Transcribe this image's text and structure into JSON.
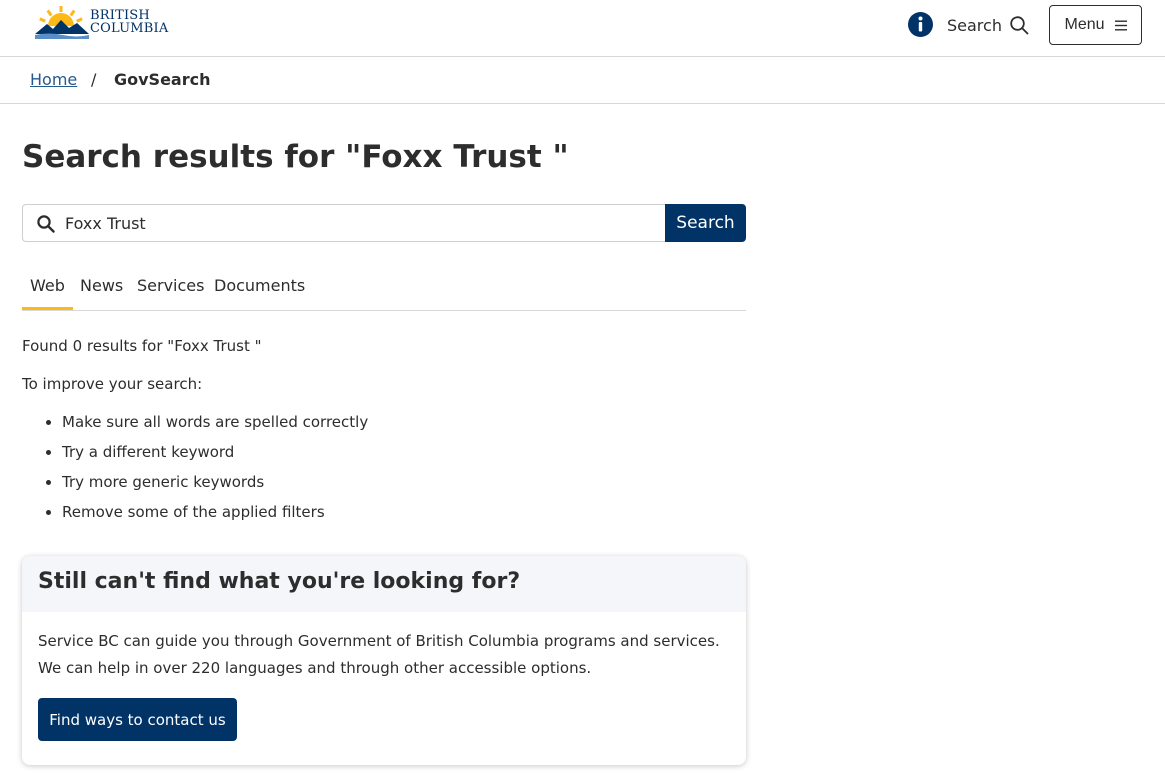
{
  "header": {
    "logo_line1": "BRITISH",
    "logo_line2": "COLUMBIA",
    "search_label": "Search",
    "menu_label": "Menu",
    "info_icon": "info-circle-icon",
    "search_icon": "magnifier-icon",
    "menu_icon": "hamburger-icon"
  },
  "breadcrumb": {
    "home": "Home",
    "separator": "/",
    "current": "GovSearch"
  },
  "main": {
    "title": "Search results for \"Foxx Trust \"",
    "search_value": "Foxx Trust",
    "search_button": "Search",
    "tabs": [
      {
        "label": "Web",
        "active": true
      },
      {
        "label": "News",
        "active": false
      },
      {
        "label": "Services",
        "active": false
      },
      {
        "label": "Documents",
        "active": false
      }
    ],
    "found_text": "Found 0 results for \"Foxx Trust \"",
    "improve_text": "To improve your search:",
    "tips": [
      "Make sure all words are spelled correctly",
      "Try a different keyword",
      "Try more generic keywords",
      "Remove some of the applied filters"
    ]
  },
  "card": {
    "title": "Still can't find what you're looking for?",
    "line1": "Service BC can guide you through Government of British Columbia programs and services.",
    "line2": "We can help in over 220 languages and through other accessible options.",
    "button": "Find ways to contact us"
  },
  "colors": {
    "brand_blue": "#013366",
    "accent_gold": "#fcba19",
    "link_blue": "#255a90"
  }
}
